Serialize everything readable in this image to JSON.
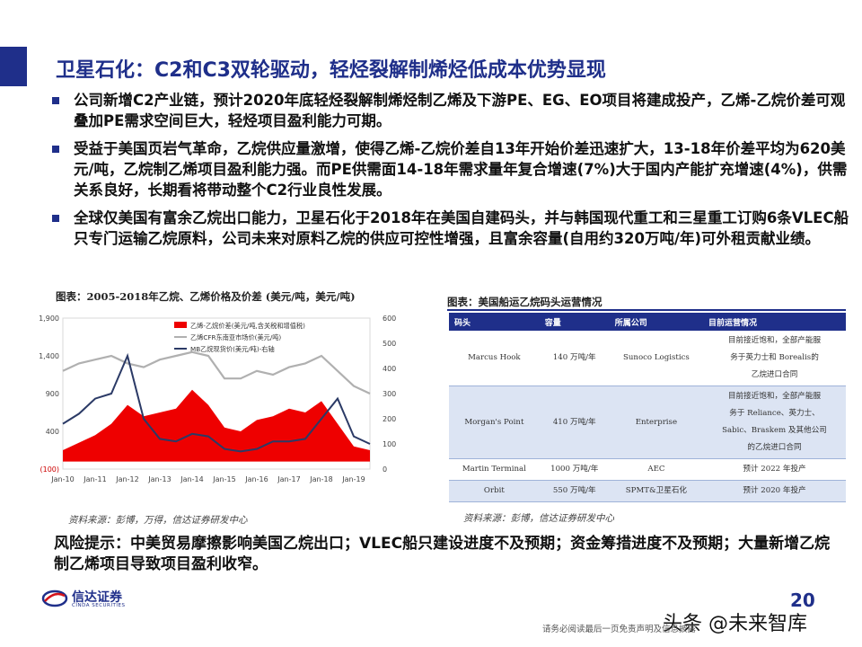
{
  "header": {
    "title": "卫星石化：C2和C3双轮驱动，轻烃裂解制烯烃低成本优势显现"
  },
  "bullets": [
    "公司新增C2产业链，预计2020年底轻烃裂解制烯烃制乙烯及下游PE、EG、EO项目将建成投产，乙烯-乙烷价差可观叠加PE需求空间巨大，轻烃项目盈利能力可期。",
    "受益于美国页岩气革命，乙烷供应量激增，使得乙烯-乙烷价差自13年开始价差迅速扩大，13-18年价差平均为620美元/吨，乙烷制乙烯项目盈利能力强。而PE供需面14-18年需求量年复合增速(7%)大于国内产能扩充增速(4%)，供需关系良好，长期看将带动整个C2行业良性发展。",
    "全球仅美国有富余乙烷出口能力，卫星石化于2018年在美国自建码头，并与韩国现代重工和三星重工订购6条VLEC船只专门运输乙烷原料，公司未来对原料乙烷的供应可控性增强，且富余容量(自用约320万吨/年)可外租贡献业绩。"
  ],
  "chart_caption": "图表：2005-2018年乙烷、乙烯价格及价差 (美元/吨，美元/吨)",
  "table_caption": "图表：美国船运乙烷码头运营情况",
  "chart_data": {
    "type": "area",
    "x": [
      "Jan-10",
      "Jul-10",
      "Jan-11",
      "Jul-11",
      "Jan-12",
      "Jul-12",
      "Jan-13",
      "Jul-13",
      "Jan-14",
      "Jul-14",
      "Jan-15",
      "Jul-15",
      "Jan-16",
      "Jul-16",
      "Jan-17",
      "Jul-17",
      "Jan-18",
      "Jul-18",
      "Jan-19",
      "Jul-19"
    ],
    "x_tick_labels": [
      "Jan-10",
      "Jan-11",
      "Jan-12",
      "Jan-13",
      "Jan-14",
      "Jan-15",
      "Jan-16",
      "Jan-17",
      "Jan-18",
      "Jan-19"
    ],
    "y_left_ticks": [
      "1,900",
      "1,400",
      "900",
      "400",
      "(100)"
    ],
    "y_left_lim": [
      -100,
      1900
    ],
    "y_right_ticks": [
      "600",
      "500",
      "400",
      "300",
      "200",
      "100",
      "0"
    ],
    "y_right_lim": [
      0,
      600
    ],
    "series": [
      {
        "name": "乙烯-乙烷价差(美元/吨,含关税和增值税)",
        "axis": "left",
        "color": "#ee0000",
        "values": [
          150,
          250,
          350,
          500,
          750,
          600,
          650,
          700,
          950,
          750,
          450,
          400,
          550,
          600,
          700,
          650,
          800,
          500,
          200,
          150
        ]
      },
      {
        "name": "乙烯CFR东南亚市场价(美元/吨)",
        "axis": "left",
        "color": "#b0b0b0",
        "values": [
          1200,
          1300,
          1350,
          1400,
          1300,
          1250,
          1350,
          1400,
          1450,
          1400,
          1100,
          1100,
          1200,
          1150,
          1250,
          1300,
          1400,
          1200,
          1000,
          900
        ]
      },
      {
        "name": "MB乙烷现货价(美元/吨)-右轴",
        "axis": "right",
        "color": "#2b3a66",
        "values": [
          180,
          220,
          280,
          300,
          450,
          200,
          120,
          110,
          140,
          130,
          80,
          70,
          80,
          110,
          110,
          120,
          200,
          280,
          130,
          100
        ]
      }
    ],
    "legend_position": "top-left",
    "grid": false
  },
  "table": {
    "headers": [
      "码头",
      "容量",
      "所属公司",
      "目前运营情况"
    ],
    "rows": [
      {
        "terminal": "Marcus Hook",
        "capacity": "140 万吨/年",
        "company": "Sunoco Logistics",
        "status": [
          "目前接近饱和，全部产能服",
          "务于英力士和 Borealis的",
          "乙烷进口合同"
        ],
        "shade": false
      },
      {
        "terminal": "Morgan's Point",
        "capacity": "410 万吨/年",
        "company": "Enterprise",
        "status": [
          "目前接近饱和，全部产能服",
          "务于 Reliance、英力士、",
          "Sabic、Braskem 及其他公司",
          "的乙烷进口合同"
        ],
        "shade": true
      },
      {
        "terminal": "Martin Terminal",
        "capacity": "1000 万吨/年",
        "company": "AEC",
        "status": [
          "预计 2022 年投产"
        ],
        "shade": false
      },
      {
        "terminal": "Orbit",
        "capacity": "550 万吨/年",
        "company": "SPMT&卫星石化",
        "status": [
          "预计 2020 年投产"
        ],
        "shade": true
      }
    ]
  },
  "source_left": "资料来源：彭博，万得，信达证券研发中心",
  "source_right": "资料来源：彭博，信达证券研发中心",
  "risk": "风险提示：中美贸易摩擦影响美国乙烷出口；VLEC船只建设进度不及预期；资金筹措进度不及预期；大量新增乙烷制乙烯项目导致项目盈利收窄。",
  "footer": {
    "logo_cn": "信达证券",
    "logo_en": "CINDA SECURITIES",
    "page_number": "20",
    "watermark": "头条 @未来智库",
    "disclaimer": "请务必阅读最后一页免责声明及信息披露"
  },
  "colors": {
    "brand": "#1f2f8a",
    "spread_fill": "#ee0000",
    "ethylene_line": "#b0b0b0",
    "ethane_line": "#2b3a66"
  }
}
